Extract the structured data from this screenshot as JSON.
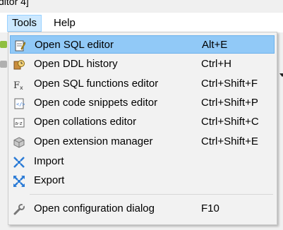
{
  "window": {
    "title_fragment": "ditor 4]"
  },
  "menubar": {
    "items": [
      {
        "label": "Tools"
      },
      {
        "label": "Help"
      }
    ]
  },
  "menu": {
    "items": [
      {
        "label": "Open SQL editor",
        "shortcut": "Alt+E",
        "icon": "sql-editor-icon",
        "highlighted": true
      },
      {
        "label": "Open DDL history",
        "shortcut": "Ctrl+H",
        "icon": "ddl-history-icon"
      },
      {
        "label": "Open SQL functions editor",
        "shortcut": "Ctrl+Shift+F",
        "icon": "functions-icon"
      },
      {
        "label": "Open code snippets editor",
        "shortcut": "Ctrl+Shift+P",
        "icon": "snippets-icon"
      },
      {
        "label": "Open collations editor",
        "shortcut": "Ctrl+Shift+C",
        "icon": "collations-icon"
      },
      {
        "label": "Open extension manager",
        "shortcut": "Ctrl+Shift+E",
        "icon": "extension-icon"
      },
      {
        "label": "Import",
        "shortcut": "",
        "icon": "import-icon"
      },
      {
        "label": "Export",
        "shortcut": "",
        "icon": "export-icon"
      },
      {
        "label": "Open configuration dialog",
        "shortcut": "F10",
        "icon": "wrench-icon"
      }
    ]
  },
  "colors": {
    "highlight": "#91c9f7",
    "menu_background": "#f2f2f2",
    "menubar_active": "#cce8ff"
  }
}
